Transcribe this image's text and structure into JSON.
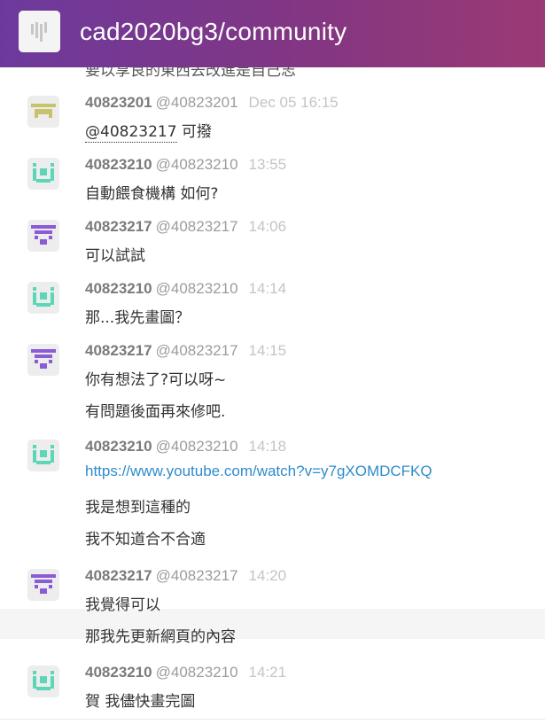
{
  "header": {
    "room_name": "cad2020bg3/community",
    "room_icon": "room-logo-icon",
    "color_start": "#6d3a9c",
    "color_end": "#9b3a74"
  },
  "clipped_text": "要以享良的東西去改進是自己志",
  "colors": {
    "link": "#2e8ccc",
    "avatar_olive": "#c8c26a",
    "avatar_teal": "#5cd6b8",
    "avatar_purple": "#8a5cd6"
  },
  "messages": [
    {
      "user": "40823201",
      "handle": "@40823201",
      "time": "Dec 05 16:15",
      "avatar": "olive",
      "lines": [
        {
          "mention": "@40823217",
          "text": " 可撥"
        }
      ]
    },
    {
      "user": "40823210",
      "handle": "@40823210",
      "time": "13:55",
      "avatar": "teal",
      "lines": [
        {
          "text": "自動餵食機構 如何?"
        }
      ]
    },
    {
      "user": "40823217",
      "handle": "@40823217",
      "time": "14:06",
      "avatar": "purple",
      "lines": [
        {
          "text": "可以試試"
        }
      ]
    },
    {
      "user": "40823210",
      "handle": "@40823210",
      "time": "14:14",
      "avatar": "teal",
      "lines": [
        {
          "text": "那...我先畫圖？"
        }
      ]
    },
    {
      "user": "40823217",
      "handle": "@40823217",
      "time": "14:15",
      "avatar": "purple",
      "lines": [
        {
          "text": "你有想法了?可以呀~"
        },
        {
          "text": "有問題後面再來修吧."
        }
      ]
    },
    {
      "user": "40823210",
      "handle": "@40823210",
      "time": "14:18",
      "avatar": "teal",
      "lines": [
        {
          "link": "https://www.youtube.com/watch?v=y7gXOMDCFKQ"
        },
        {
          "text": "我是想到這種的"
        },
        {
          "text": "我不知道合不合適"
        }
      ]
    },
    {
      "user": "40823217",
      "handle": "@40823217",
      "time": "14:20",
      "avatar": "purple",
      "lines": [
        {
          "text": "我覺得可以"
        },
        {
          "text": "那我先更新網頁的內容"
        }
      ]
    },
    {
      "user": "40823210",
      "handle": "@40823210",
      "time": "14:21",
      "avatar": "teal",
      "lines": [
        {
          "text": "賀 我儘快畫完圖"
        }
      ]
    }
  ]
}
